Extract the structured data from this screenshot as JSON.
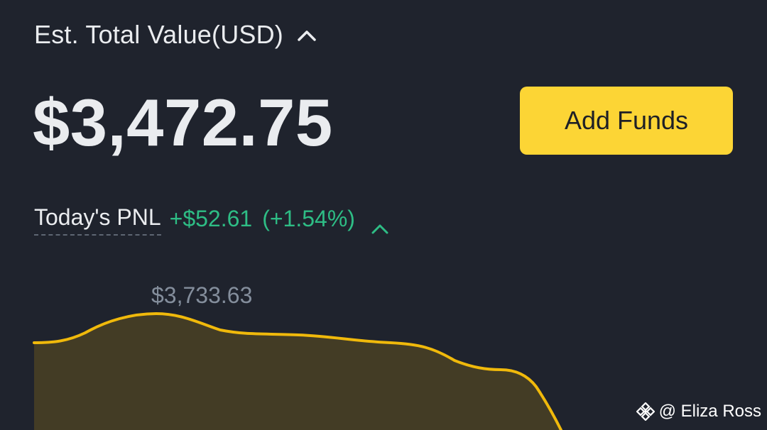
{
  "header": {
    "title": "Est. Total Value(USD)",
    "chevron_icon": "chevron-up-icon"
  },
  "balance": {
    "total_value": "$3,472.75"
  },
  "actions": {
    "add_funds_label": "Add Funds"
  },
  "pnl": {
    "label": "Today's PNL",
    "value": "+$52.61",
    "percent": "(+1.54%)",
    "chevron_icon": "chevron-up-icon"
  },
  "chart": {
    "peak_label": "$3,733.63"
  },
  "watermark": {
    "icon": "binance-logo-icon",
    "text": "@ Eliza Ross"
  },
  "colors": {
    "background": "#1f232d",
    "accent": "#fcd535",
    "positive": "#2ebd85",
    "text_primary": "#eaecef",
    "text_secondary": "#848e9c",
    "chart_line": "#f0b90b",
    "chart_fill": "#433c25"
  }
}
